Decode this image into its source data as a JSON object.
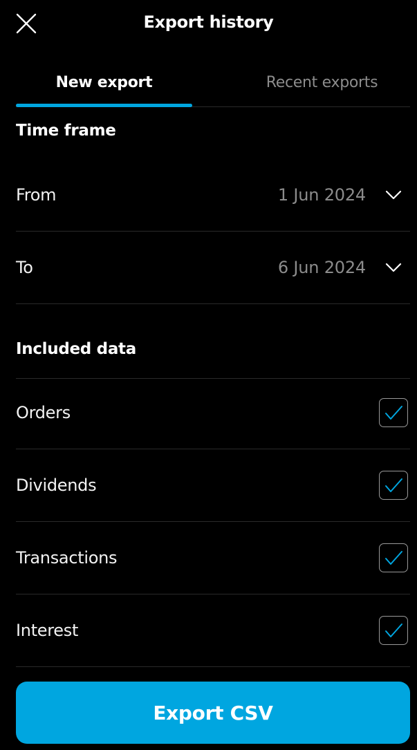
{
  "header": {
    "title": "Export history",
    "close_icon": "close-icon"
  },
  "tabs": [
    {
      "label": "New export",
      "active": true
    },
    {
      "label": "Recent exports",
      "active": false
    }
  ],
  "time_frame": {
    "title": "Time frame",
    "from": {
      "label": "From",
      "value": "1 Jun 2024"
    },
    "to": {
      "label": "To",
      "value": "6 Jun 2024"
    }
  },
  "included_data": {
    "title": "Included data",
    "items": [
      {
        "label": "Orders",
        "checked": true
      },
      {
        "label": "Dividends",
        "checked": true
      },
      {
        "label": "Transactions",
        "checked": true
      },
      {
        "label": "Interest",
        "checked": true
      }
    ]
  },
  "export_button": {
    "label": "Export CSV"
  },
  "colors": {
    "background": "#000000",
    "accent": "#00a6e0",
    "muted_text": "#8c8c8c",
    "divider": "#2a2a2a"
  }
}
